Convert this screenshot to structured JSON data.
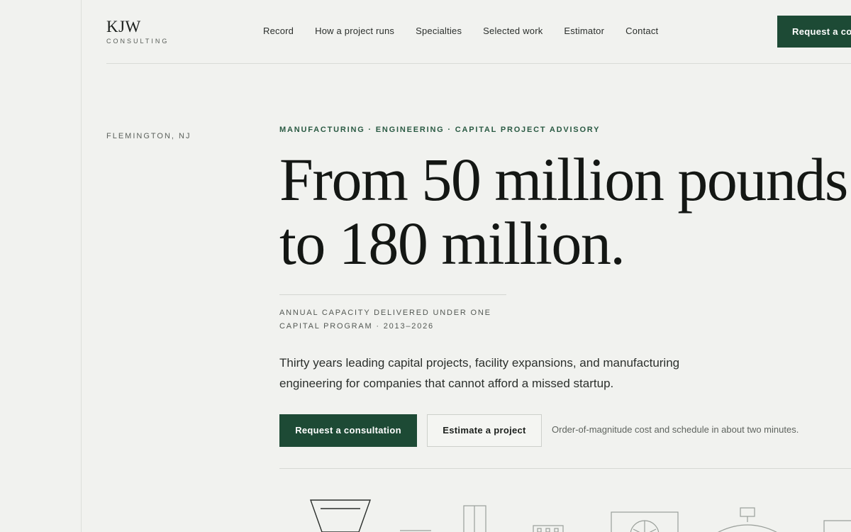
{
  "brand": {
    "name": "KJW",
    "subtitle": "CONSULTING"
  },
  "nav": {
    "items": [
      {
        "label": "Record"
      },
      {
        "label": "How a project runs"
      },
      {
        "label": "Specialties"
      },
      {
        "label": "Selected work"
      },
      {
        "label": "Estimator"
      },
      {
        "label": "Contact"
      }
    ],
    "cta_label": "Request a consultation"
  },
  "hero": {
    "location": "FLEMINGTON, NJ",
    "eyebrow": "MANUFACTURING · ENGINEERING · CAPITAL PROJECT ADVISORY",
    "headline_line1": "From 50 million pounds",
    "headline_line2": "to 180 million.",
    "stat_caption_line1": "ANNUAL CAPACITY DELIVERED UNDER ONE",
    "stat_caption_line2": "CAPITAL PROGRAM · 2013–2026",
    "lede": "Thirty years leading capital projects, facility expansions, and manufacturing engineering for companies that cannot afford a missed startup.",
    "primary_cta": "Request a consultation",
    "secondary_cta": "Estimate a project",
    "cta_note": "Order-of-magnitude cost and schedule in about two minutes."
  },
  "colors": {
    "background": "#f1f2ef",
    "accent": "#1d4a35",
    "eyebrow": "#2a5a43",
    "ink": "#141714"
  },
  "icons": {
    "illustration": [
      "hopper-icon",
      "conveyor-icon",
      "silo-icon",
      "control-panel-icon",
      "mixer-fan-icon",
      "reactor-vessel-icon",
      "tank-icon"
    ]
  }
}
